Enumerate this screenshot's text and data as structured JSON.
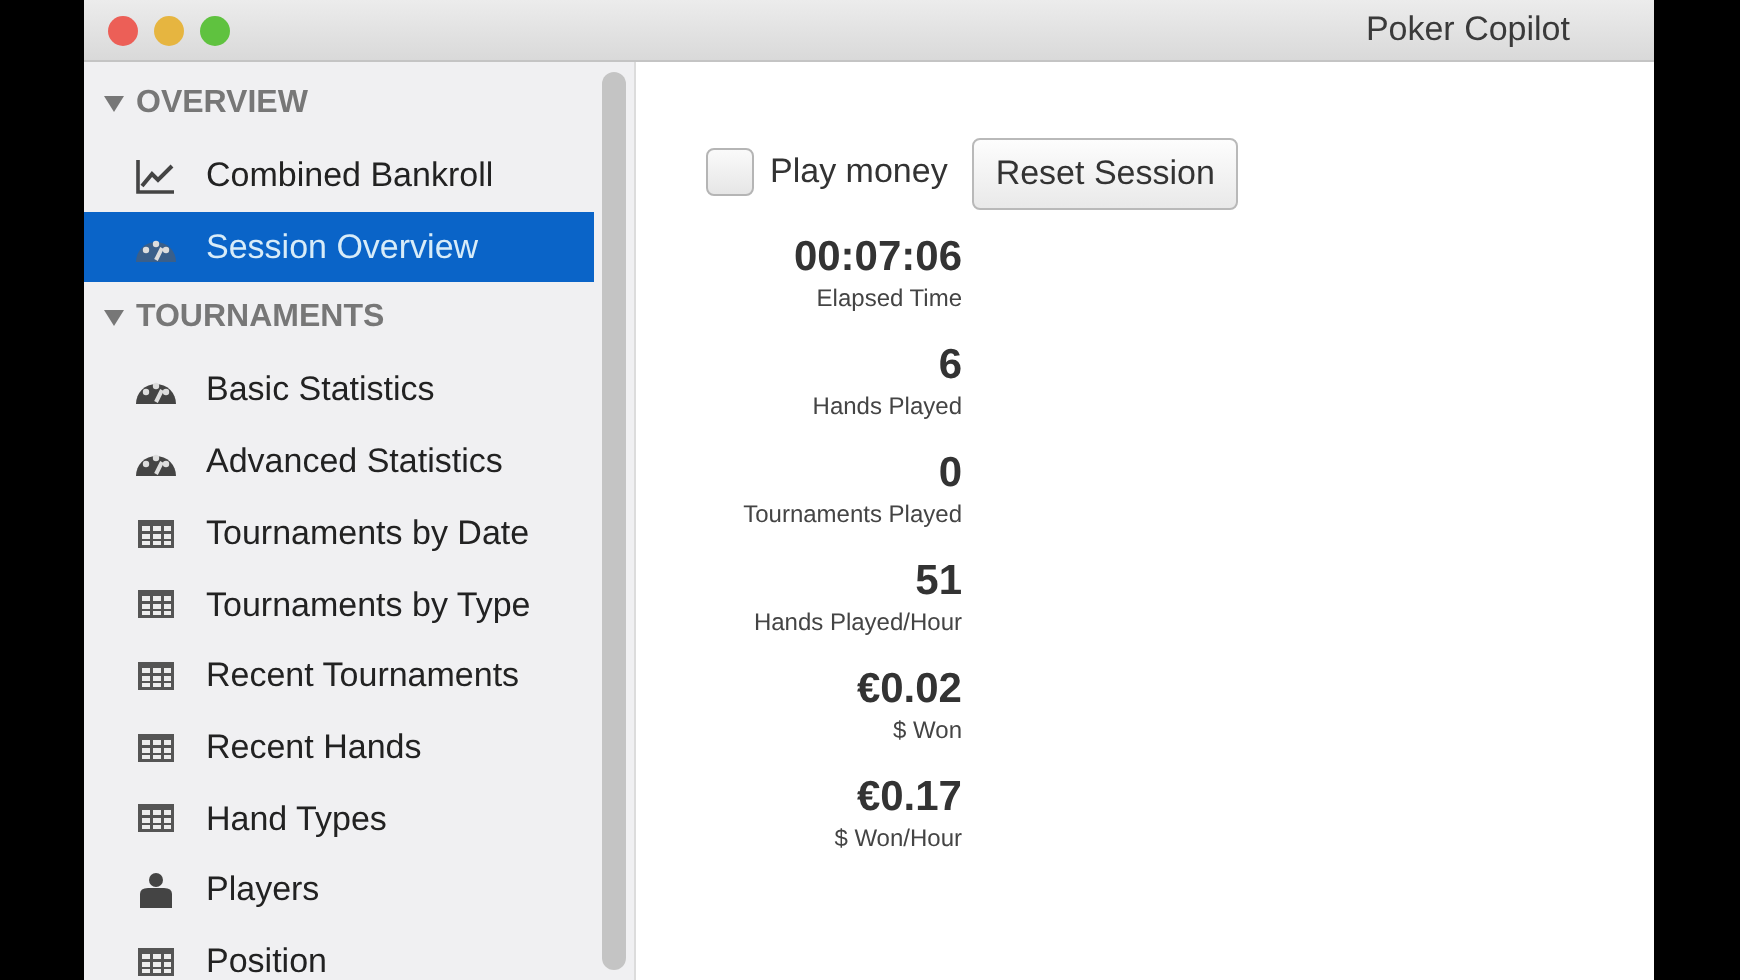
{
  "window": {
    "title": "Poker Copilot"
  },
  "sidebar": {
    "sections": [
      {
        "title": "OVERVIEW",
        "expanded": true,
        "items": [
          {
            "label": "Combined Bankroll",
            "kind": "chart",
            "selected": false
          },
          {
            "label": "Session Overview",
            "kind": "gauge",
            "selected": true
          }
        ]
      },
      {
        "title": "TOURNAMENTS",
        "expanded": true,
        "items": [
          {
            "label": "Basic Statistics",
            "kind": "gauge",
            "selected": false
          },
          {
            "label": "Advanced Statistics",
            "kind": "gauge",
            "selected": false
          },
          {
            "label": "Tournaments by Date",
            "kind": "table",
            "selected": false
          },
          {
            "label": "Tournaments by Type",
            "kind": "table",
            "selected": false
          },
          {
            "label": "Recent Tournaments",
            "kind": "table",
            "selected": false
          },
          {
            "label": "Recent Hands",
            "kind": "table",
            "selected": false
          },
          {
            "label": "Hand Types",
            "kind": "table",
            "selected": false
          },
          {
            "label": "Players",
            "kind": "person",
            "selected": false
          },
          {
            "label": "Position",
            "kind": "table",
            "selected": false
          }
        ]
      }
    ]
  },
  "play_money": {
    "label": "Play money",
    "checked": false
  },
  "reset_button": "Reset Session",
  "stats": [
    {
      "value": "00:07:06",
      "label": "Elapsed Time"
    },
    {
      "value": "6",
      "label": "Hands Played"
    },
    {
      "value": "0",
      "label": "Tournaments Played"
    },
    {
      "value": "51",
      "label": "Hands Played/Hour"
    },
    {
      "value": "€0.02",
      "label": "$ Won"
    },
    {
      "value": "€0.17",
      "label": "$ Won/Hour"
    }
  ]
}
